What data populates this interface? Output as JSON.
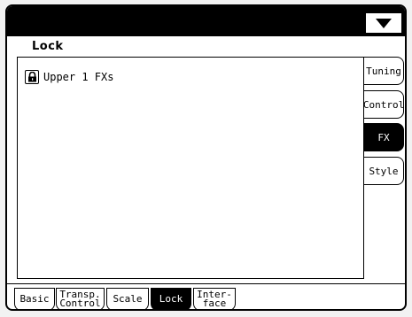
{
  "page": {
    "title": "Lock"
  },
  "lock_items": [
    {
      "label": "Upper 1 FXs",
      "icon": "padlock-icon"
    }
  ],
  "side_tabs": [
    {
      "label": "Tuning",
      "active": false
    },
    {
      "label": "Control",
      "active": false
    },
    {
      "label": "FX",
      "active": true
    },
    {
      "label": "Style",
      "active": false
    }
  ],
  "bottom_tabs": [
    {
      "label": "Basic",
      "active": false
    },
    {
      "line1": "Transp.",
      "line2": "Control",
      "active": false
    },
    {
      "label": "Scale",
      "active": false
    },
    {
      "label": "Lock",
      "active": true
    },
    {
      "line1": "Inter-",
      "line2": "face",
      "active": false
    }
  ],
  "header": {
    "menu_icon": "triangle-down-icon"
  }
}
